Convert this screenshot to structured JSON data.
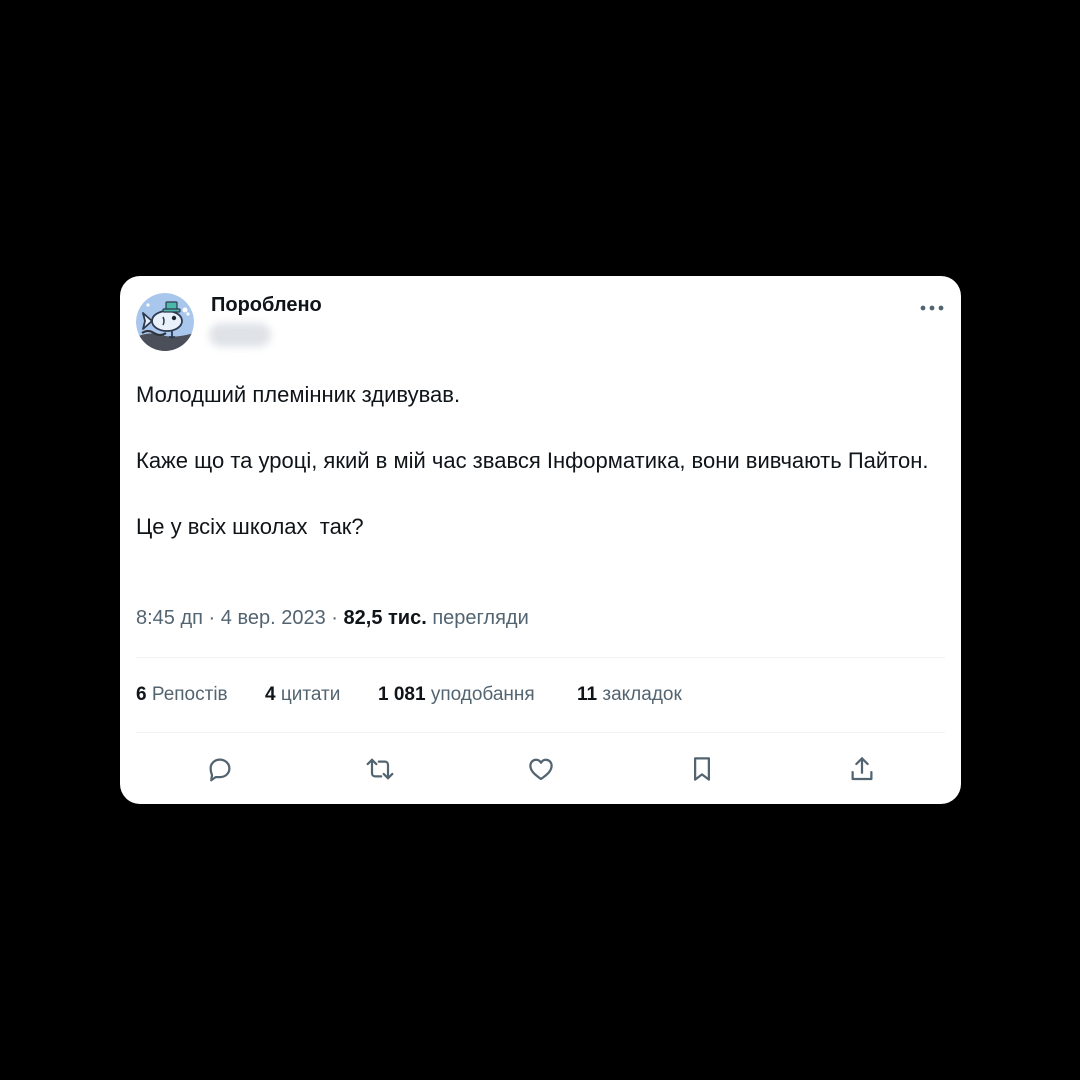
{
  "tweet": {
    "author_name": "Пороблено",
    "avatar_icon": "fish-icon",
    "paragraphs": [
      "Молодший племінник здивував.",
      "Каже що та уроці, який в мій час звався Інформатика, вони вивчають Пайтон.",
      "Це у всіх школах  так?"
    ],
    "time": "8:45 дп",
    "date": "4 вер. 2023",
    "views_count": "82,5 тис.",
    "views_label": "перегляди",
    "separator": "·"
  },
  "stats": {
    "reposts": {
      "count": "6",
      "label": "Репостів"
    },
    "quotes": {
      "count": "4",
      "label": "цитати"
    },
    "likes": {
      "count": "1 081",
      "label": "уподобання"
    },
    "bookmarks": {
      "count": "11",
      "label": "закладок"
    }
  },
  "actions": [
    "reply-icon",
    "retweet-icon",
    "like-icon",
    "bookmark-icon",
    "share-icon"
  ],
  "colors": {
    "background": "#000000",
    "card": "#ffffff",
    "text_primary": "#0f1419",
    "text_secondary": "#536471",
    "divider": "#eff3f4"
  }
}
